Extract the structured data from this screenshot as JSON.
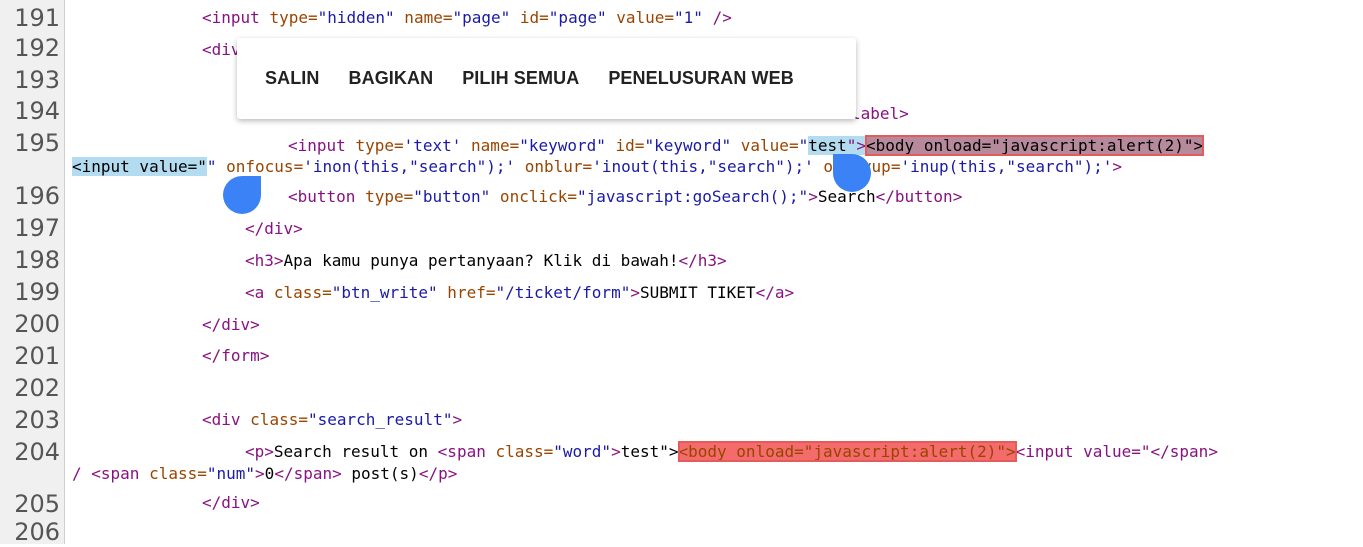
{
  "line_numbers": [
    "191",
    "192",
    "193",
    "194",
    "195",
    "196",
    "197",
    "198",
    "199",
    "200",
    "201",
    "202",
    "203",
    "204",
    "205",
    "206"
  ],
  "code": {
    "l191": {
      "a": "<input ",
      "b": "type=",
      "c": "\"hidden\"",
      "d": " name=",
      "e": "\"page\"",
      "f": " id=",
      "g": "\"page\"",
      "h": " value=",
      "i": "\"1\"",
      "j": " />"
    },
    "l192": {
      "a": "<div"
    },
    "l194": {
      "a": "label>"
    },
    "l195": {
      "a": "<input ",
      "b": "type=",
      "c": "'text'",
      "d": " name=",
      "e": "\"keyword\"",
      "f": " id=",
      "g": "\"keyword\"",
      "h": " value=",
      "i": "\"",
      "j": "test",
      "k": "\">",
      "l": "<body onload=\"javascript:alert(2)\">"
    },
    "l195b": {
      "a": "<input value=\"",
      "b": "\"",
      "c": " onfocus=",
      "d": "'inon(this,\"search\");'",
      "e": " onblur=",
      "f": "'inout(this,\"search\");'",
      "g": " onkeyup=",
      "h": "'inup(this,\"search\");'",
      "i": ">"
    },
    "l196": {
      "a": "<button ",
      "b": "type=",
      "c": "\"button\"",
      "d": " onclick=",
      "e": "\"javascript:goSearch();\"",
      "f": ">",
      "g": "Search",
      "h": "</button>"
    },
    "l197": {
      "a": "</div>"
    },
    "l198": {
      "a": "<h3>",
      "b": "Apa kamu punya pertanyaan? Klik di bawah!",
      "c": "</h3>"
    },
    "l199": {
      "a": "<a ",
      "b": "class=",
      "c": "\"btn_write\"",
      "d": " href=",
      "e": "\"/ticket/form\"",
      "f": ">",
      "g": "SUBMIT TIKET",
      "h": "</a>"
    },
    "l200": {
      "a": "</div>"
    },
    "l201": {
      "a": "</form>"
    },
    "l203": {
      "a": "<div ",
      "b": "class=",
      "c": "\"search_result\"",
      "d": ">"
    },
    "l204": {
      "a": "<p>",
      "b": "Search result on ",
      "c": "<span ",
      "d": "class=",
      "e": "\"word\"",
      "f": ">",
      "g": "test\">",
      "h": "<body onload=\"javascript:alert(2)\">",
      "i": "<input value=\"",
      "j": "</span>"
    },
    "l204b": {
      "a": "/ ",
      "b": "<span ",
      "c": "class=",
      "d": "\"num\"",
      "e": ">",
      "f": "0",
      "g": "</span>",
      "h": " post(s)",
      "i": "</p>"
    },
    "l205": {
      "a": "</div>"
    }
  },
  "context_menu": {
    "items": [
      "SALIN",
      "BAGIKAN",
      "PILIH SEMUA",
      "PENELUSURAN WEB"
    ]
  },
  "colors": {
    "selection": "#b3dcf0",
    "highlight": "#f36b6b",
    "handle": "#3b82f6",
    "tag": "#881280",
    "attribute": "#994500",
    "value": "#1a1aa6"
  }
}
